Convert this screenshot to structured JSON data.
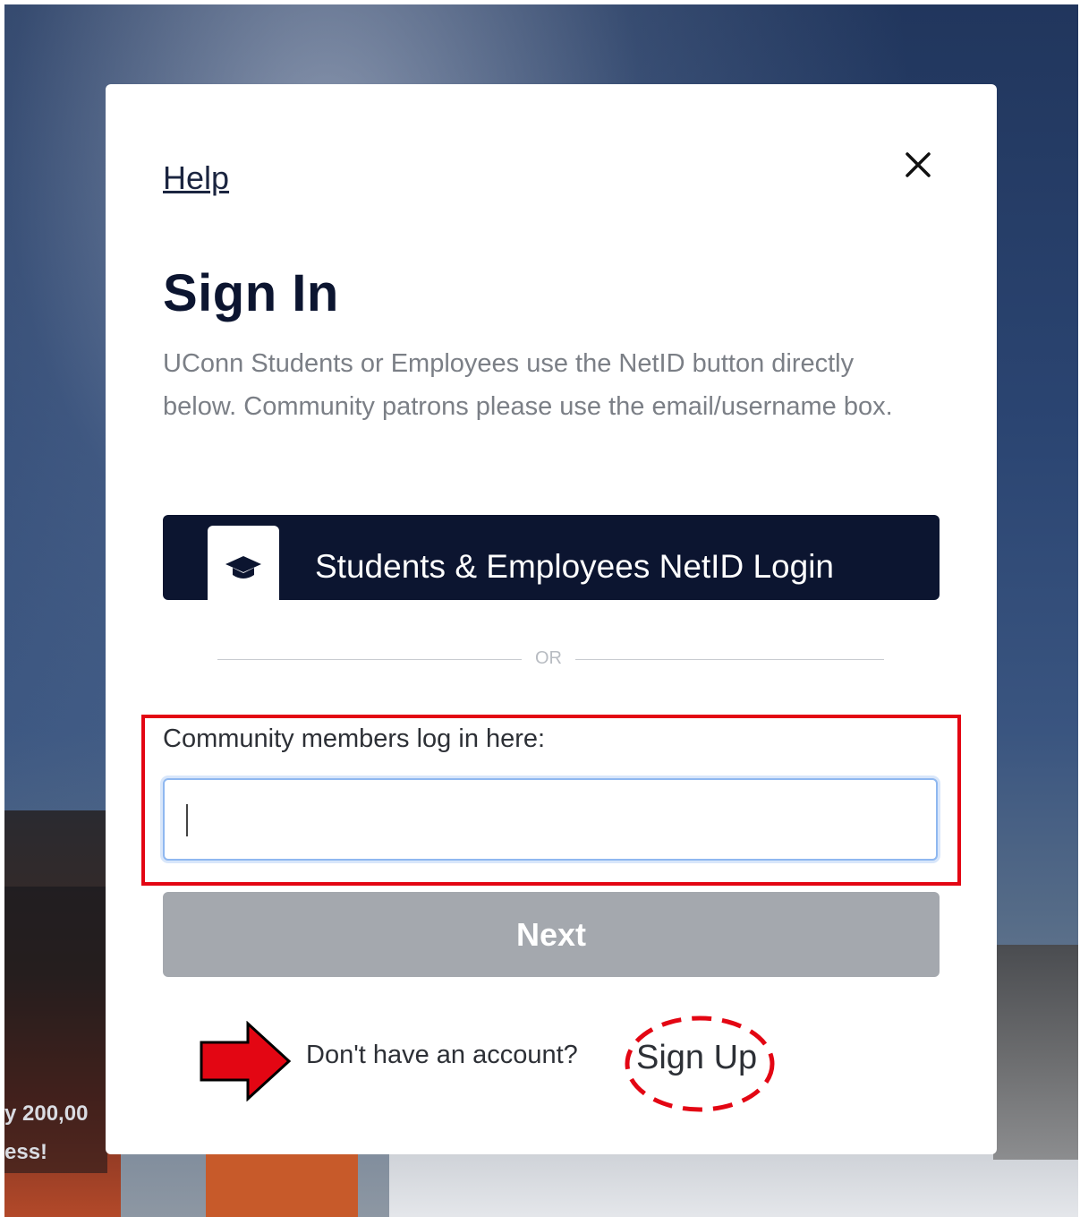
{
  "background": {
    "partial_text_line1": "y 200,00",
    "partial_text_line2": "ess!"
  },
  "modal": {
    "help_label": "Help",
    "close_icon": "close-icon",
    "title": "Sign In",
    "intro": "UConn Students or Employees use the NetID button directly below. Community patrons please use the email/username box.",
    "netid_button": {
      "label": "Students & Employees NetID Login",
      "icon": "graduation-cap-icon"
    },
    "divider_label": "OR",
    "community": {
      "label": "Community members log in here:",
      "input_value": "",
      "input_placeholder": ""
    },
    "next_label": "Next",
    "signup_prompt": "Don't have an account?",
    "signup_label": "Sign Up"
  },
  "annotations": {
    "highlight_color": "#e30613",
    "arrow_icon": "right-arrow-icon"
  },
  "colors": {
    "navy": "#0c1530",
    "disabled_button": "#a4a8ae",
    "input_focus": "#8fb8f0"
  }
}
